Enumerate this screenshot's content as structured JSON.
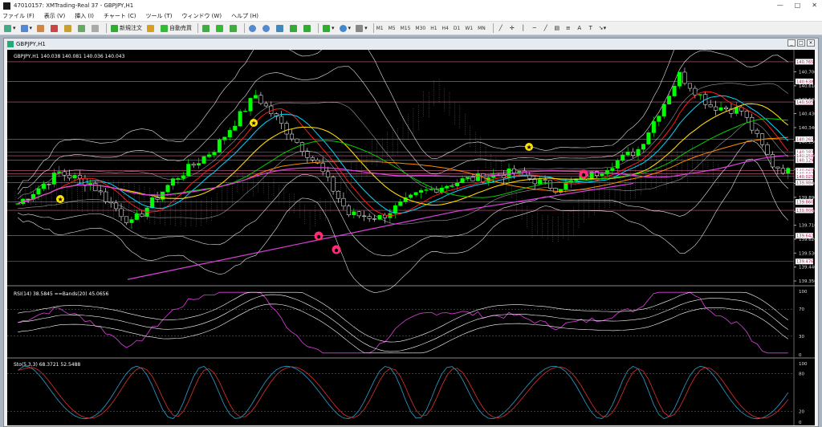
{
  "window": {
    "title": "47010157: XMTrading-Real 37 - GBPJPY,H1",
    "min": "—",
    "max": "□",
    "close": "✕"
  },
  "menu": [
    "ファイル (F)",
    "表示 (V)",
    "挿入 (I)",
    "チャート (C)",
    "ツール (T)",
    "ウィンドウ (W)",
    "ヘルプ (H)"
  ],
  "toolbar": {
    "new_order": "新規注文",
    "auto_trade": "自動売買",
    "timeframes": [
      "M1",
      "M5",
      "M15",
      "M30",
      "H1",
      "H4",
      "D1",
      "W1",
      "MN"
    ]
  },
  "chart_window": {
    "title": "GBPJPY,H1"
  },
  "main_panel": {
    "header": "GBPJPY,H1  140.038 140.081 140.036 140.043",
    "price_axis": [
      "140.700",
      "140.610",
      "140.520",
      "140.430",
      "140.340",
      "140.250",
      "140.160",
      "140.070",
      "139.980",
      "139.890",
      "139.800",
      "139.710",
      "139.620",
      "139.530",
      "139.440",
      "139.350"
    ],
    "level_tags": [
      "140.765",
      "140.638",
      "140.505",
      "140.265",
      "140.183",
      "140.158",
      "140.129",
      "140.063",
      "140.043",
      "140.025",
      "139.984",
      "139.860",
      "139.806",
      "139.642",
      "139.476"
    ]
  },
  "rsi_panel": {
    "header": "RSI(14) 38.5845   ==Bands(20) 45.0656",
    "axis": [
      "100",
      "70",
      "30",
      "0"
    ]
  },
  "stoch_panel": {
    "header": "Sto(5,3,3) 68.3721 52.5488",
    "axis": [
      "100",
      "80",
      "20",
      "0"
    ]
  },
  "colors": {
    "background": "#000000",
    "bull": "#00ff00",
    "bear": "#ffffff",
    "ma_yellow": "#ffd800",
    "ma_orange": "#ff8c00",
    "ma_green": "#00d000",
    "ma_cyan": "#00d8ff",
    "ma_magenta": "#e040e0",
    "tenkan": "#ff1a1a",
    "levels": "#ff80b0"
  }
}
